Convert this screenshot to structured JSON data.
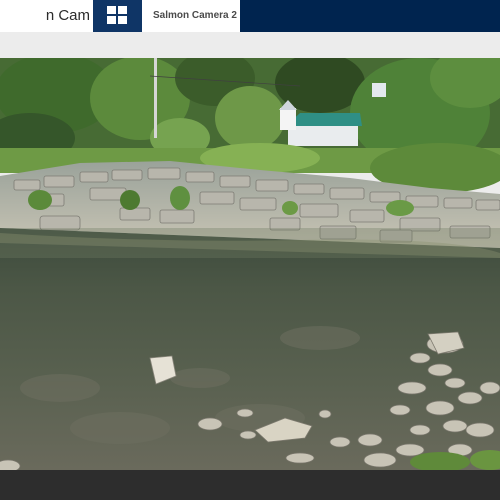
{
  "header": {
    "title": "n Cam",
    "grid_icon": "grid-icon",
    "camera_tab_label": "Salmon Camera 2"
  },
  "colors": {
    "header_bg": "#00244f",
    "grid_button_bg": "#0f3566",
    "tab_bg": "#ffffff",
    "page_bg": "#ececec",
    "footer_bg": "#2d2d2d"
  },
  "camera_view": {
    "description_icon": "river-camera-feed"
  }
}
